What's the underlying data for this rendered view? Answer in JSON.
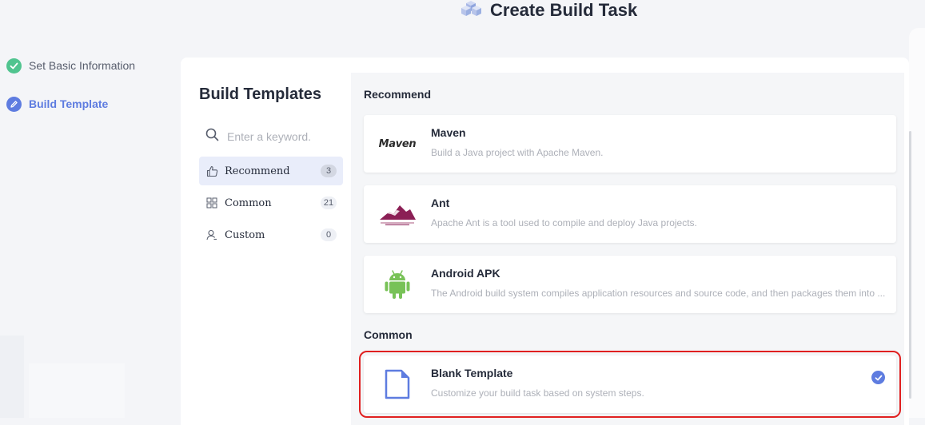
{
  "page": {
    "title": "Create Build Task"
  },
  "steps": [
    {
      "label": "Set Basic Information",
      "state": "done"
    },
    {
      "label": "Build Template",
      "state": "active"
    }
  ],
  "templates": {
    "title": "Build Templates",
    "search_placeholder": "Enter a keyword.",
    "categories": [
      {
        "label": "Recommend",
        "count": "3",
        "icon": "thumbs-up-icon",
        "selected": true
      },
      {
        "label": "Common",
        "count": "21",
        "icon": "grid-icon",
        "selected": false
      },
      {
        "label": "Custom",
        "count": "0",
        "icon": "user-icon",
        "selected": false
      }
    ]
  },
  "recommend": {
    "title": "Recommend",
    "items": [
      {
        "name": "Maven",
        "desc": "Build a Java project with Apache Maven.",
        "logo_text": "Maven",
        "icon": "maven-logo"
      },
      {
        "name": "Ant",
        "desc": "Apache Ant is a tool used to compile and deploy Java projects.",
        "icon": "ant-logo"
      },
      {
        "name": "Android APK",
        "desc": "The Android build system compiles application resources and source code, and then packages them into ...",
        "icon": "android-icon"
      }
    ]
  },
  "common": {
    "title": "Common",
    "items": [
      {
        "name": "Blank Template",
        "desc": "Customize your build task based on system steps.",
        "icon": "blank-document-icon",
        "selected": true
      }
    ]
  },
  "colors": {
    "accent": "#5e7ce0",
    "success": "#50c48f",
    "highlight_border": "#e02020",
    "android": "#78c257",
    "ant": "#8b1f55"
  }
}
